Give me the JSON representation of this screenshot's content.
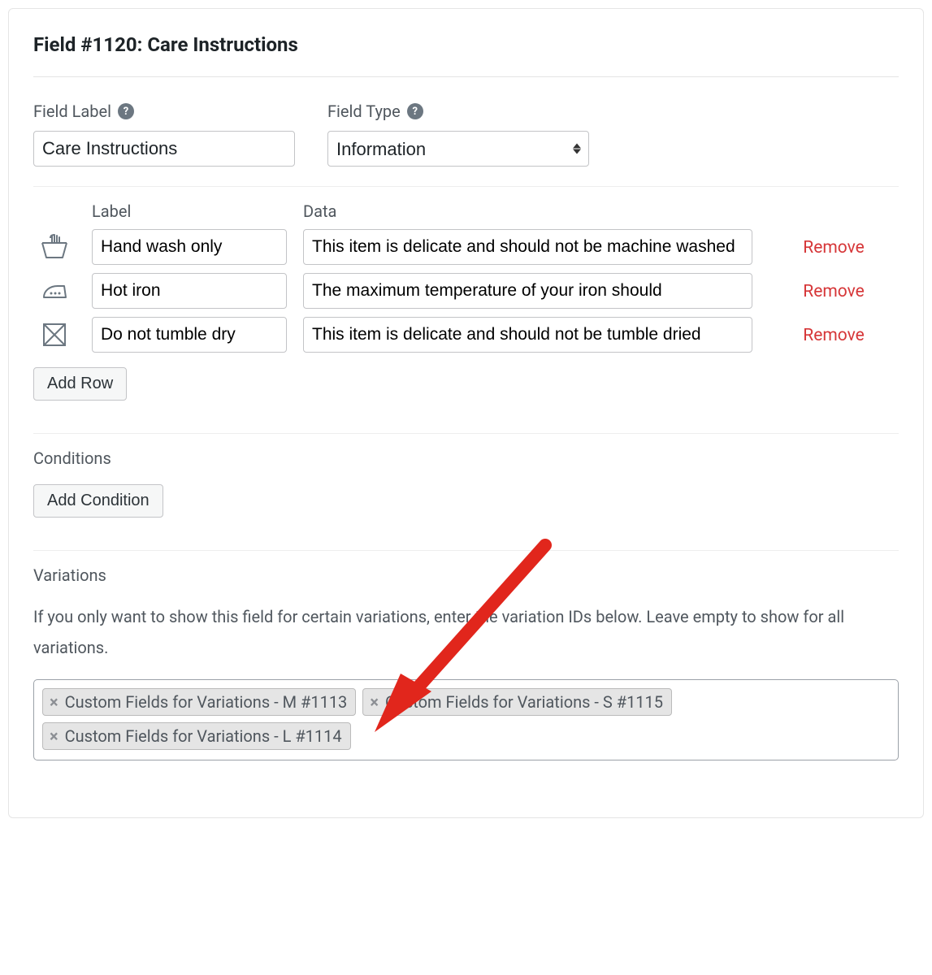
{
  "panel_title": "Field #1120: Care Instructions",
  "field_label": {
    "label": "Field Label",
    "value": "Care Instructions"
  },
  "field_type": {
    "label": "Field Type",
    "value": "Information"
  },
  "table": {
    "headers": {
      "label": "Label",
      "data": "Data"
    },
    "rows": [
      {
        "icon": "hand-wash-icon",
        "label": "Hand wash only",
        "data": "This item is delicate and should not be machine washed",
        "remove": "Remove"
      },
      {
        "icon": "iron-icon",
        "label": "Hot iron",
        "data": "The maximum temperature of your iron should",
        "remove": "Remove"
      },
      {
        "icon": "no-tumble-dry-icon",
        "label": "Do not tumble dry",
        "data": "This item is delicate and should not be tumble dried",
        "remove": "Remove"
      }
    ],
    "add_row": "Add Row"
  },
  "conditions": {
    "heading": "Conditions",
    "add_button": "Add Condition"
  },
  "variations": {
    "heading": "Variations",
    "helper": "If you only want to show this field for certain variations, enter the variation IDs below. Leave empty to show for all variations.",
    "tags": [
      "Custom Fields for Variations - M #1113",
      "Custom Fields for Variations - S #1115",
      "Custom Fields for Variations - L #1114"
    ]
  }
}
